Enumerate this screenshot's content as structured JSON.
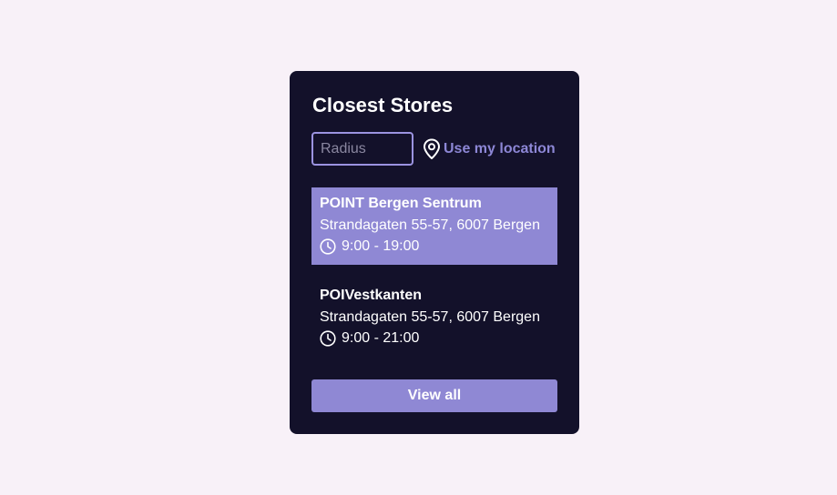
{
  "widget": {
    "title": "Closest Stores",
    "radius_placeholder": "Radius",
    "radius_value": "",
    "location_label": "Use my location",
    "view_all_label": "View all"
  },
  "stores": [
    {
      "name": "POINT Bergen Sentrum",
      "address": "Strandagaten 55-57, 6007 Bergen",
      "hours": "9:00 - 19:00",
      "selected": true
    },
    {
      "name": "POIVestkanten",
      "address": "Strandagaten 55-57, 6007 Bergen",
      "hours": "9:00 - 21:00",
      "selected": false
    }
  ],
  "icons": {
    "location": "map-pin-icon",
    "hours": "clock-icon"
  },
  "colors": {
    "page_background": "#f8f1f8",
    "card_background": "#13112a",
    "accent": "#8f88d4",
    "text": "#ffffff"
  }
}
